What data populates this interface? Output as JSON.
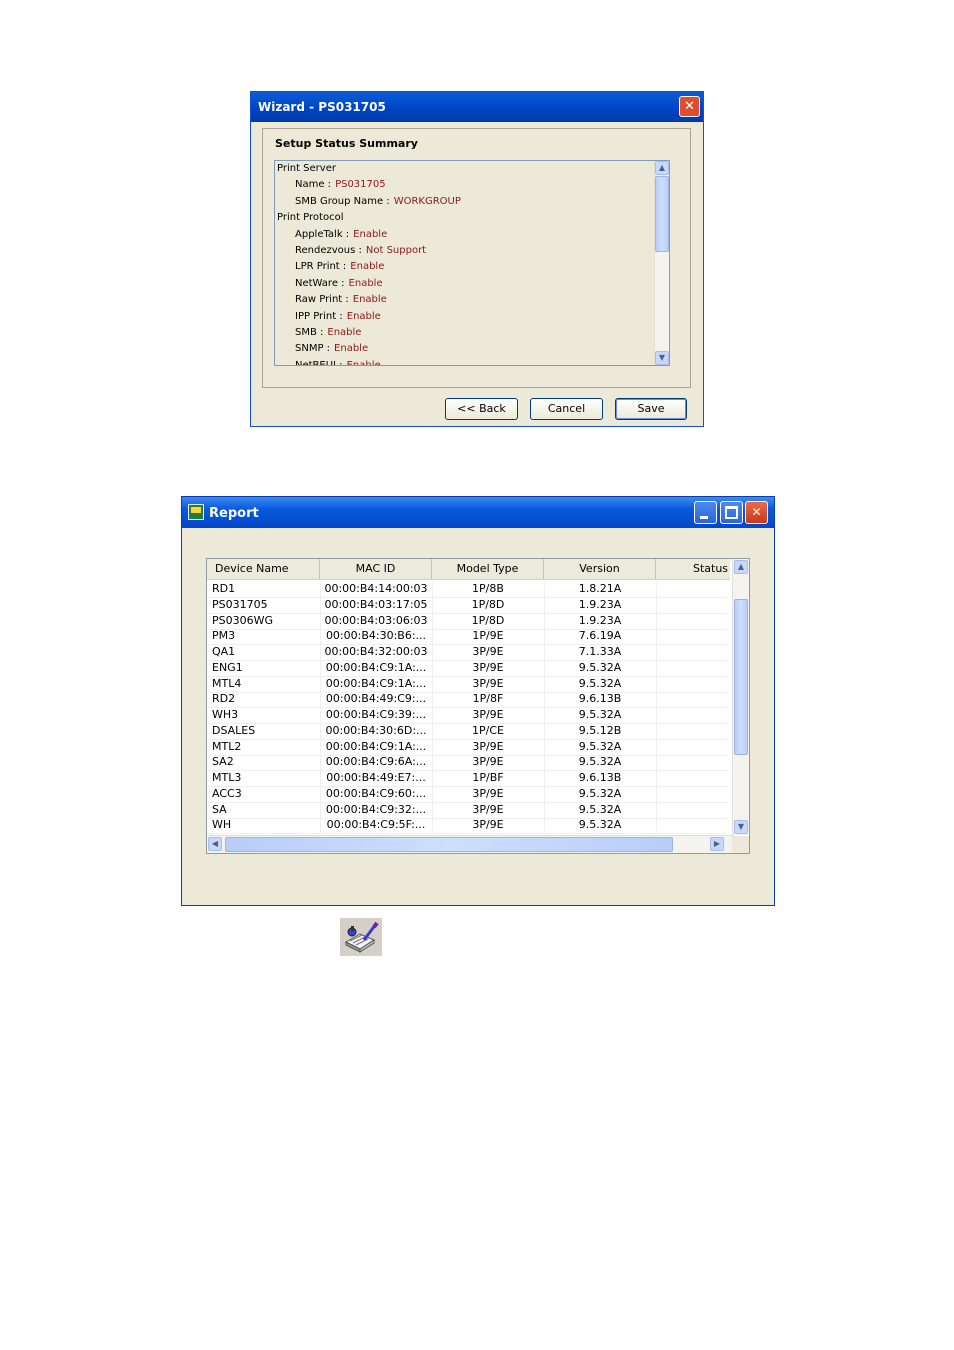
{
  "wizard": {
    "title": "Wizard - PS031705",
    "close_glyph": "✕",
    "heading": "Setup Status Summary",
    "sections": [
      {
        "label": "Print Server",
        "items": [
          {
            "label": "Name :",
            "value": "PS031705"
          },
          {
            "label": "SMB Group Name :",
            "value": "WORKGROUP"
          }
        ]
      },
      {
        "label": "Print Protocol",
        "items": [
          {
            "label": "AppleTalk :",
            "value": "Enable"
          },
          {
            "label": "Rendezvous :",
            "value": "Not Support"
          },
          {
            "label": "LPR Print :",
            "value": "Enable"
          },
          {
            "label": "NetWare :",
            "value": "Enable"
          },
          {
            "label": "Raw Print :",
            "value": "Enable"
          },
          {
            "label": "IPP Print :",
            "value": "Enable"
          },
          {
            "label": "SMB :",
            "value": "Enable"
          },
          {
            "label": "SNMP :",
            "value": "Enable"
          },
          {
            "label": "NetBEUI :",
            "value": "Enable"
          }
        ]
      }
    ],
    "buttons": {
      "back": "<< Back",
      "cancel": "Cancel",
      "save": "Save"
    },
    "value_color": "#8b1a1a"
  },
  "report": {
    "title": "Report",
    "columns": [
      "Device Name",
      "MAC ID",
      "Model Type",
      "Version",
      "Status"
    ],
    "rows": [
      [
        "RD1",
        "00:00:B4:14:00:03",
        "1P/8B",
        "1.8.21A"
      ],
      [
        "PS031705",
        "00:00:B4:03:17:05",
        "1P/8D",
        "1.9.23A"
      ],
      [
        "PS0306WG",
        "00:00:B4:03:06:03",
        "1P/8D",
        "1.9.23A"
      ],
      [
        "PM3",
        "00:00:B4:30:B6:...",
        "1P/9E",
        "7.6.19A"
      ],
      [
        "QA1",
        "00:00:B4:32:00:03",
        "3P/9E",
        "7.1.33A"
      ],
      [
        "ENG1",
        "00:00:B4:C9:1A:...",
        "3P/9E",
        "9.5.32A"
      ],
      [
        "MTL4",
        "00:00:B4:C9:1A:...",
        "3P/9E",
        "9.5.32A"
      ],
      [
        "RD2",
        "00:00:B4:49:C9:...",
        "1P/8F",
        "9.6.13B"
      ],
      [
        "WH3",
        "00:00:B4:C9:39:...",
        "3P/9E",
        "9.5.32A"
      ],
      [
        "DSALES",
        "00:00:B4:30:6D:...",
        "1P/CE",
        "9.5.12B"
      ],
      [
        "MTL2",
        "00:00:B4:C9:1A:...",
        "3P/9E",
        "9.5.32A"
      ],
      [
        "SA2",
        "00:00:B4:C9:6A:...",
        "3P/9E",
        "9.5.32A"
      ],
      [
        "MTL3",
        "00:00:B4:49:E7:...",
        "1P/BF",
        "9.6.13B"
      ],
      [
        "ACC3",
        "00:00:B4:C9:60:...",
        "3P/9E",
        "9.5.32A"
      ],
      [
        "SA",
        "00:00:B4:C9:32:...",
        "3P/9E",
        "9.5.32A"
      ],
      [
        "WH",
        "00:00:B4:C9:5F:...",
        "3P/9E",
        "9.5.32A"
      ]
    ]
  },
  "icons": {
    "tool": "edit-settings-icon"
  }
}
